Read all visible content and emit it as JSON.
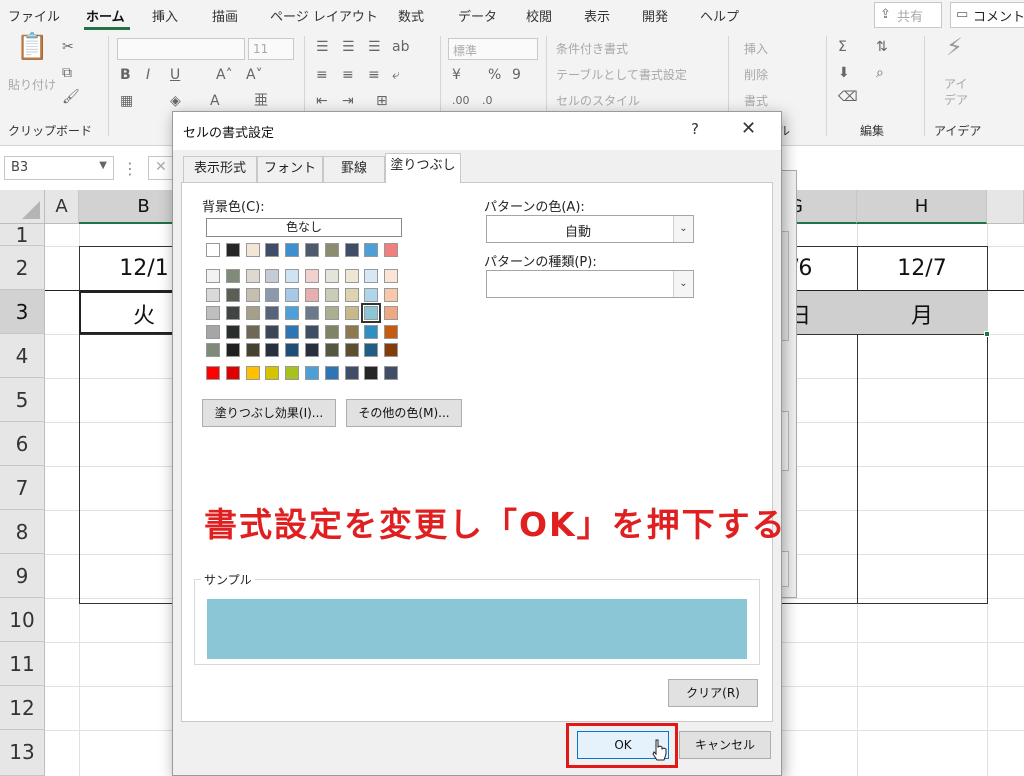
{
  "ribbon_tabs": [
    "ファイル",
    "ホーム",
    "挿入",
    "描画",
    "ページ レイアウト",
    "数式",
    "データ",
    "校閲",
    "表示",
    "開発",
    "ヘルプ"
  ],
  "share_label": "共有",
  "comment_label": "コメント",
  "ribbon": {
    "paste_label": "貼り付け",
    "font_size": "11",
    "number_format": "標準",
    "conditional_format": "条件付き書式",
    "table_format": "テーブルとして書式設定",
    "cell_style": "セルのスタイル",
    "insert": "挿入",
    "delete": "削除",
    "format": "書式",
    "ideas": "アイデア",
    "groups": {
      "clipboard": "クリップボード",
      "cells_partial": "ル",
      "edit": "編集",
      "ideas": "アイデア"
    }
  },
  "namebox": "B3",
  "columns": [
    "A",
    "B",
    "G",
    "H"
  ],
  "rows": [
    "1",
    "2",
    "3",
    "4",
    "5",
    "6",
    "7",
    "8",
    "9",
    "10",
    "11",
    "12",
    "13"
  ],
  "cells": {
    "B2": "12/1",
    "B3": "火",
    "G2": "/6",
    "G3": "日",
    "H2": "12/7",
    "H3": "月"
  },
  "dialog": {
    "title": "セルの書式設定",
    "help": "?",
    "close": "✕",
    "tabs": [
      "表示形式",
      "フォント",
      "罫線",
      "塗りつぶし"
    ],
    "active_tab": "塗りつぶし",
    "bg_color_label": "背景色(C):",
    "no_color": "色なし",
    "pattern_color_label": "パターンの色(A):",
    "pattern_color_value": "自動",
    "pattern_type_label": "パターンの種類(P):",
    "pattern_type_value": "",
    "fill_effects": "塗りつぶし効果(I)...",
    "more_colors": "その他の色(M)...",
    "sample_label": "サンプル",
    "sample_color": "#8ac6d6",
    "clear": "クリア(R)",
    "ok": "OK",
    "cancel": "キャンセル"
  },
  "annotation": "書式設定を変更し「OK」を押下する",
  "colors": {
    "theme_top": [
      "#ffffff",
      "#262626",
      "#f2e6d6",
      "#3f4e66",
      "#3f8fcf",
      "#4e5a6b",
      "#8c8c6e",
      "#3f4e66",
      "#4e9fd6",
      "#f08080"
    ],
    "theme_rows": [
      [
        "#f2f2f2",
        "#7f8a7a",
        "#ddd9cf",
        "#c5cbd6",
        "#cfe3f2",
        "#f2d0d0",
        "#e2e6da",
        "#ece6d2",
        "#d6e8f4",
        "#fbe4d5"
      ],
      [
        "#d9d9d9",
        "#595f55",
        "#c4bfae",
        "#8c99ad",
        "#a5c9e6",
        "#e6b0b0",
        "#c7cdb6",
        "#ddd3b0",
        "#b0d4ec",
        "#f7c9aa"
      ],
      [
        "#bfbfbf",
        "#3f4540",
        "#a69f8a",
        "#56647a",
        "#4f9fd9",
        "#6a7a8c",
        "#a9b090",
        "#c9b88a",
        "#8ac6d6",
        "#f0a880"
      ],
      [
        "#a6a6a6",
        "#2b2f2c",
        "#6e6855",
        "#3c4757",
        "#2e75b6",
        "#3f4e66",
        "#7f8564",
        "#8c7a4e",
        "#2e8fc4",
        "#c55a11"
      ],
      [
        "#7f8a7a",
        "#1e211f",
        "#46422f",
        "#283040",
        "#1f4e79",
        "#283040",
        "#545840",
        "#5c5030",
        "#1f5f85",
        "#833c0b"
      ]
    ],
    "standard": [
      "#ff0000",
      "#e00000",
      "#ffc000",
      "#d4c400",
      "#a8c020",
      "#4e9fd6",
      "#2e75b6",
      "#3f4e66",
      "#262626",
      "#3f4e66"
    ]
  }
}
